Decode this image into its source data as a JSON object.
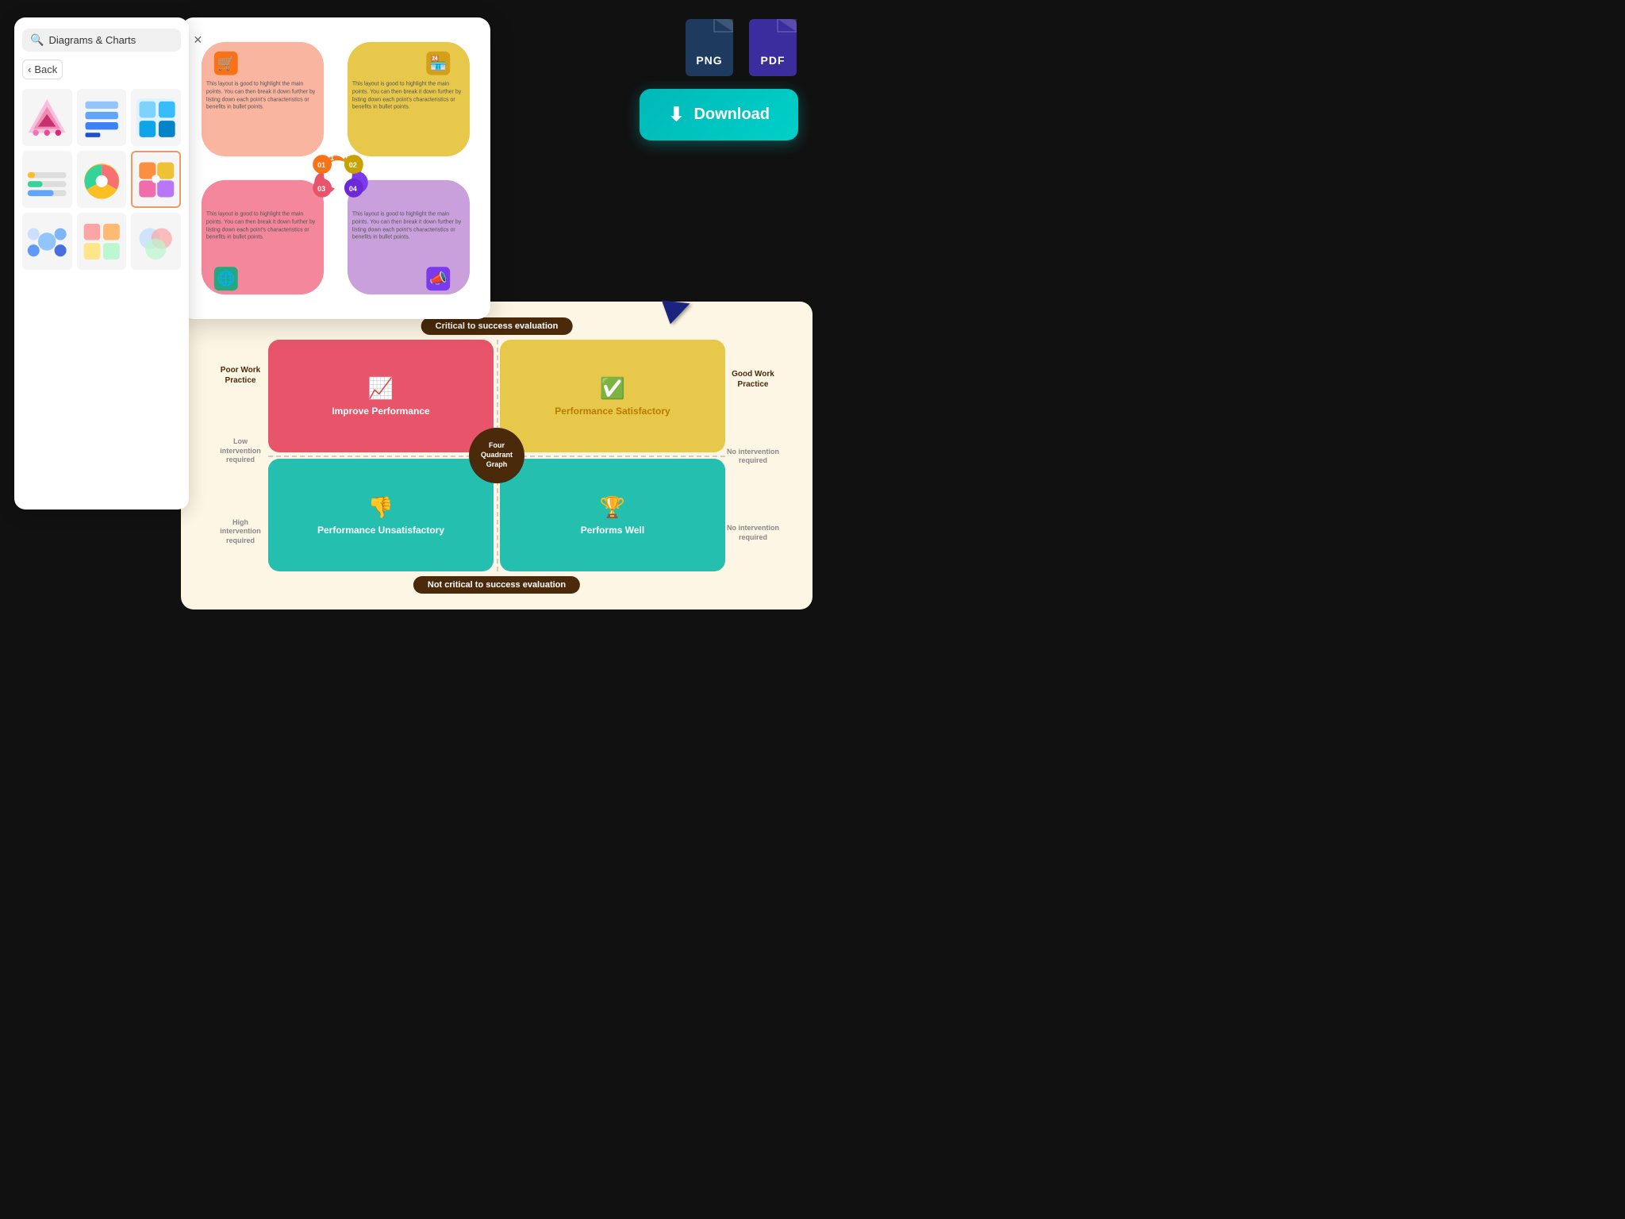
{
  "sidebar": {
    "search_placeholder": "Diagrams & Charts",
    "back_label": "Back",
    "title": "Diagrams & Charts"
  },
  "download": {
    "png_label": "PNG",
    "pdf_label": "PDF",
    "button_label": "Download"
  },
  "main_diagram": {
    "sections": [
      {
        "number": "01",
        "text": "This layout is good to highlight the main points. You can then break it down further by listing down each point's characteristics or benefits in bullet points."
      },
      {
        "number": "02",
        "text": "This layout is good to highlight the main points. You can then break it down further by listing down each point's characteristics or benefits in bullet points."
      },
      {
        "number": "03",
        "text": "This layout is good to highlight the main points. You can then break it down further by listing down each point's characteristics or benefits in bullet points."
      },
      {
        "number": "04",
        "text": "This layout is good to highlight the main points. You can then break it down further by listing down each point's characteristics or benefits in bullet points."
      }
    ]
  },
  "quadrant": {
    "title_top": "Critical to success evaluation",
    "title_bottom": "Not critical to success evaluation",
    "center_label": "Four Quadrant Graph",
    "quad_tl_label": "Improve Performance",
    "quad_tr_label": "Performance Satisfactory",
    "quad_bl_label": "Performance Unsatisfactory",
    "quad_br_label": "Performs Well",
    "left_top": "Low intervention required",
    "left_bottom": "High intervention required",
    "right_top": "No intervention required",
    "right_bottom": "No intervention required",
    "label_left_top": "Poor Work Practice",
    "label_right_top": "Good Work Practice"
  }
}
